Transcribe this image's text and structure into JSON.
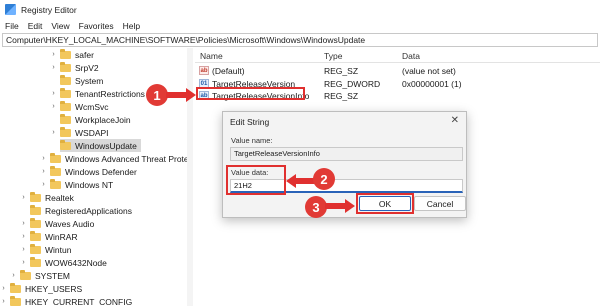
{
  "window": {
    "title": "Registry Editor"
  },
  "menu": [
    "File",
    "Edit",
    "View",
    "Favorites",
    "Help"
  ],
  "address": "Computer\\HKEY_LOCAL_MACHINE\\SOFTWARE\\Policies\\Microsoft\\Windows\\WindowsUpdate",
  "tree": {
    "items": [
      {
        "label": "safer",
        "expandable": true
      },
      {
        "label": "SrpV2",
        "expandable": true
      },
      {
        "label": "System",
        "expandable": false
      },
      {
        "label": "TenantRestrictions",
        "expandable": true
      },
      {
        "label": "WcmSvc",
        "expandable": true
      },
      {
        "label": "WorkplaceJoin",
        "expandable": false
      },
      {
        "label": "WSDAPI",
        "expandable": true
      },
      {
        "label": "WindowsUpdate",
        "expandable": false,
        "selected": true
      },
      {
        "label": "Windows Advanced Threat Protec",
        "expandable": true
      },
      {
        "label": "Windows Defender",
        "expandable": true
      },
      {
        "label": "Windows NT",
        "expandable": true
      },
      {
        "label": "Realtek",
        "expandable": true
      },
      {
        "label": "RegisteredApplications",
        "expandable": false
      },
      {
        "label": "Waves Audio",
        "expandable": true
      },
      {
        "label": "WinRAR",
        "expandable": true
      },
      {
        "label": "Wintun",
        "expandable": true
      },
      {
        "label": "WOW6432Node",
        "expandable": true
      },
      {
        "label": "SYSTEM",
        "expandable": true
      },
      {
        "label": "HKEY_USERS",
        "expandable": true
      },
      {
        "label": "HKEY_CURRENT_CONFIG",
        "expandable": true
      }
    ]
  },
  "list": {
    "headers": {
      "name": "Name",
      "type": "Type",
      "data": "Data"
    },
    "rows": [
      {
        "icon": "string-value-icon",
        "name": "(Default)",
        "type": "REG_SZ",
        "data": "(value not set)"
      },
      {
        "icon": "dword-value-icon",
        "name": "TargetReleaseVersion",
        "type": "REG_DWORD",
        "data": "0x00000001 (1)"
      },
      {
        "icon": "string-value-icon",
        "name": "TargetReleaseVersionInfo",
        "type": "REG_SZ",
        "data": ""
      }
    ]
  },
  "dialog": {
    "title": "Edit String",
    "close": "✕",
    "value_name_label": "Value name:",
    "value_name": "TargetReleaseVersionInfo",
    "value_data_label": "Value data:",
    "value_data": "21H2",
    "ok": "OK",
    "cancel": "Cancel"
  },
  "annotations": {
    "step1": "1",
    "step2": "2",
    "step3": "3"
  },
  "colors": {
    "annotation": "#e0302f",
    "folder": "#f2c75c",
    "selection": "#d9d9d9",
    "focus": "#2a63b8"
  }
}
